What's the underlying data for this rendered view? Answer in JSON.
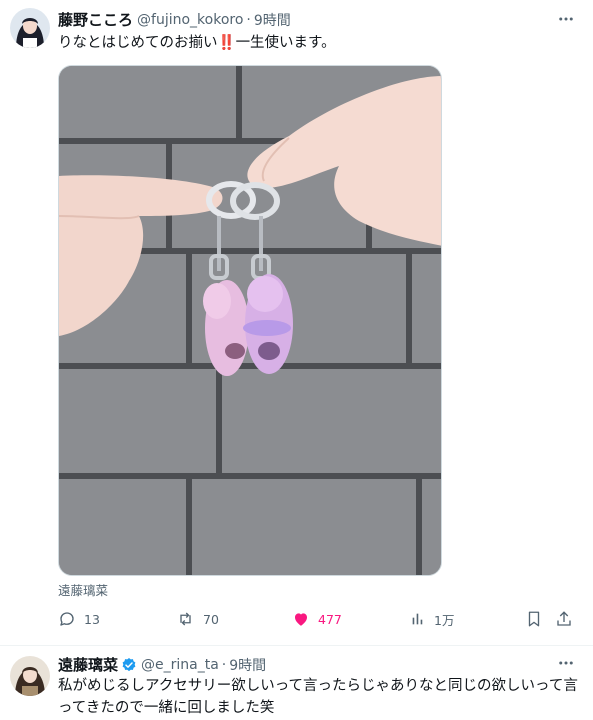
{
  "tweet1": {
    "author_name": "藤野こころ",
    "handle": "@fujino_kokoro",
    "separator": "·",
    "time": "9時間",
    "text_before": "りなとはじめてのお揃い",
    "text_emoji": "‼️",
    "text_after": "一生使います。",
    "media_caption": "遠藤璃菜",
    "actions": {
      "reply_count": "13",
      "retweet_count": "70",
      "like_count": "477",
      "view_count": "1万"
    },
    "liked": true
  },
  "tweet2": {
    "author_name": "遠藤璃菜",
    "verified": true,
    "handle": "@e_rina_ta",
    "separator": "·",
    "time": "9時間",
    "text": "私がめじるしアクセサリー欲しいって言ったらじゃありなと同じの欲しいって言ってきたので一緒に回しました笑"
  },
  "colors": {
    "text": "#0f1419",
    "secondary": "#536471",
    "like": "#f91880",
    "verified": "#1d9bf0",
    "emoji_red": "#e0245e"
  }
}
